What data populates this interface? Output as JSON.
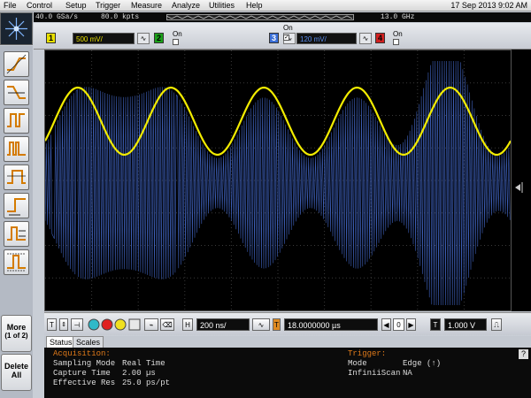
{
  "menu": {
    "items": [
      "File",
      "Control",
      "Setup",
      "Trigger",
      "Measure",
      "Analyze",
      "Utilities",
      "Help"
    ],
    "datetime": "17 Sep 2013  9:02 AM"
  },
  "acquisition_header": {
    "sample_rate": "40.0 GSa/s",
    "memory_depth": "80.0 kpts",
    "bandwidth": "13.0 GHz"
  },
  "channels": [
    {
      "number": "1",
      "on_label": "",
      "scale": "500 mV/",
      "color": "#e8e000",
      "checked": true
    },
    {
      "number": "2",
      "on_label": "On",
      "scale": "",
      "color": "#1aa01a",
      "checked": false
    },
    {
      "number": "3",
      "on_label": "On",
      "scale": "120 mV/",
      "color": "#3a6fd8",
      "checked": true
    },
    {
      "number": "4",
      "on_label": "On",
      "scale": "",
      "color": "#d02020",
      "checked": false
    }
  ],
  "side_buttons": {
    "more_label": "More",
    "more_page": "(1 of 2)",
    "delete_label": "Delete",
    "delete_sub": "All"
  },
  "controls": {
    "horizontal_label": "H",
    "horizontal_scale": "200 ns/",
    "horizontal_position": "18.0000000 µs",
    "trigger_label": "T",
    "trigger_level": "1.000 V",
    "stepper_value": "0"
  },
  "tabs": [
    "Status",
    "Scales"
  ],
  "status": {
    "acquisition_title": "Acquisition:",
    "acquisition_rows": [
      {
        "label": "Sampling Mode",
        "value": "Real Time"
      },
      {
        "label": "Capture Time",
        "value": "2.00 µs"
      },
      {
        "label": "Effective Res",
        "value": "25.0 ps/pt"
      }
    ],
    "trigger_title": "Trigger:",
    "trigger_rows": [
      {
        "label": "Mode",
        "value": "Edge (↑)"
      },
      {
        "label": "InfiniiScan",
        "value": "NA"
      }
    ],
    "help_label": "?"
  },
  "colors": {
    "channel1_trace": "#f2ec00",
    "channel3_trace": "#3d5fb8",
    "status_header": "#e07a1a",
    "screen_background": "#000000"
  }
}
